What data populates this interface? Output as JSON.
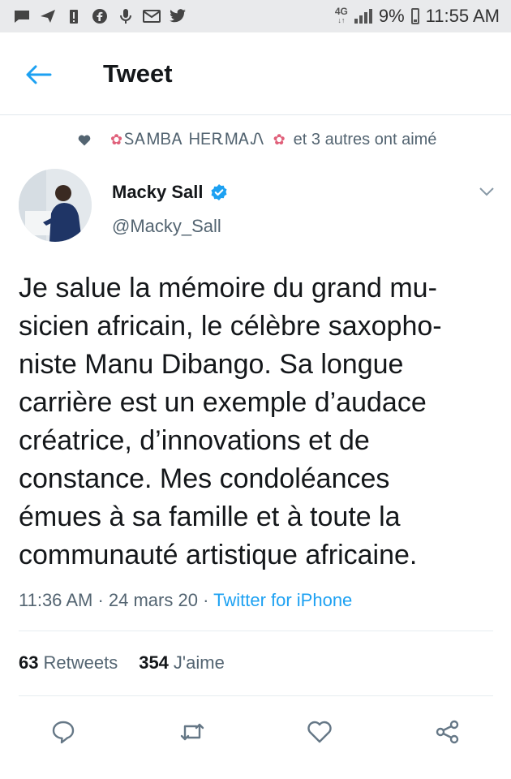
{
  "status_bar": {
    "network": "4G",
    "network_sub": "↓↑",
    "battery": "9%",
    "time": "11:55 AM",
    "notification_icons": [
      "chat-icon",
      "send-icon",
      "battery-alert-icon",
      "facebook-icon",
      "microphone-icon",
      "mail-icon",
      "twitter-icon"
    ]
  },
  "header": {
    "title": "Tweet"
  },
  "social_context": {
    "liker_name": "ᏚᎪᎷᏴᎪ ᎻᎬᎡᎷᎪᏁ",
    "flower_left": "✿",
    "flower_right": "✿",
    "suffix": "et 3 autres ont aimé"
  },
  "author": {
    "name": "Macky Sall",
    "handle": "@Macky_Sall",
    "verified": true
  },
  "tweet": {
    "lines": [
      "Je salue la mémoire du grand mu-",
      "sicien africain, le célèbre saxopho-",
      "niste Manu Dibango. Sa longue",
      "carrière est un exemple d’audace",
      "créatrice, d’innovations et de",
      "constance. Mes condoléances",
      "émues à sa famille et à toute la",
      "communauté artistique africaine."
    ],
    "time": "11:36 AM",
    "date": "24 mars 20",
    "separator": " · ",
    "source": "Twitter for iPhone"
  },
  "stats": {
    "retweets_count": "63",
    "retweets_label": "Retweets",
    "likes_count": "354",
    "likes_label": "J'aime"
  },
  "colors": {
    "accent": "#1da1f2",
    "muted": "#536471",
    "text": "#14171a"
  }
}
